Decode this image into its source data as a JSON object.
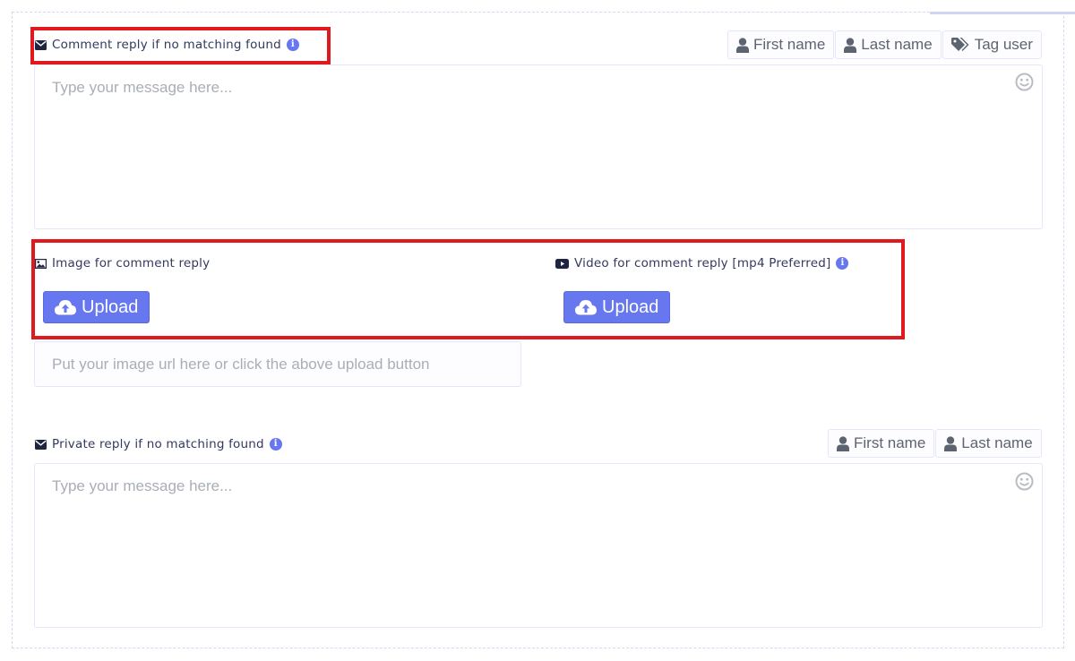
{
  "comment_reply": {
    "label": "Comment reply if no matching found",
    "placeholder": "Type your message here...",
    "tags": {
      "first_name": "First name",
      "last_name": "Last name",
      "tag_user": "Tag user"
    }
  },
  "image_section": {
    "label": "Image for comment reply",
    "upload_label": "Upload",
    "url_placeholder": "Put your image url here or click the above upload button"
  },
  "video_section": {
    "label": "Video for comment reply [mp4 Preferred]",
    "upload_label": "Upload"
  },
  "private_reply": {
    "label": "Private reply if no matching found",
    "placeholder": "Type your message here...",
    "tags": {
      "first_name": "First name",
      "last_name": "Last name"
    }
  },
  "icons": {
    "envelope": "envelope-icon",
    "image": "image-icon",
    "video": "youtube-icon",
    "info": "info-icon",
    "user": "user-icon",
    "tags": "tags-icon",
    "emoji": "smiley-icon",
    "upload": "cloud-upload-icon"
  },
  "colors": {
    "accent": "#6777ef",
    "highlight": "#e0191f",
    "label_text": "#34395e",
    "border": "#e4e6fc",
    "placeholder": "#a9aeb6"
  }
}
